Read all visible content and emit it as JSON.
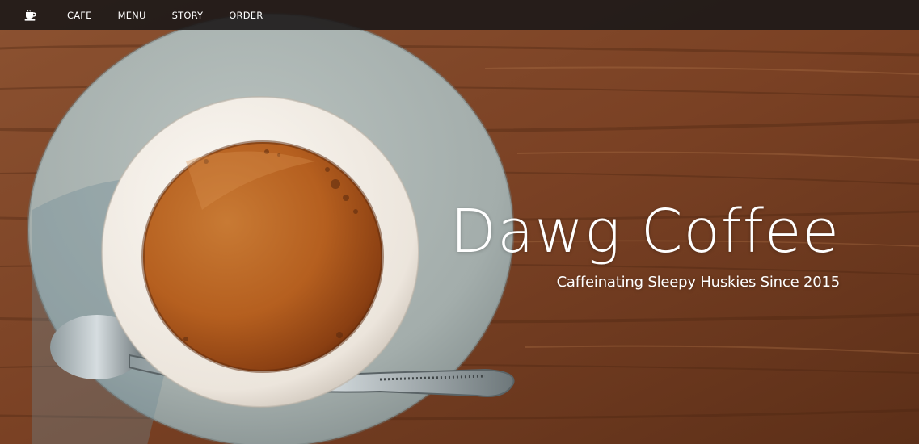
{
  "navbar": {
    "brand_icon": "coffee-cup-icon",
    "links": [
      {
        "label": "CAFE"
      },
      {
        "label": "MENU"
      },
      {
        "label": "STORY"
      },
      {
        "label": "ORDER"
      }
    ]
  },
  "hero": {
    "title": "Dawg Coffee",
    "subtitle": "Caffeinating Sleepy Huskies Since 2015",
    "background_image": "coffee-cup-on-saucer-on-wood-table-photo"
  },
  "colors": {
    "navbar_bg": "#1c1818",
    "wood": "#7a4426",
    "saucer": "#9fa9a6",
    "cup": "#f0ebe4",
    "coffee": "#b8601f",
    "text": "#ffffff"
  }
}
